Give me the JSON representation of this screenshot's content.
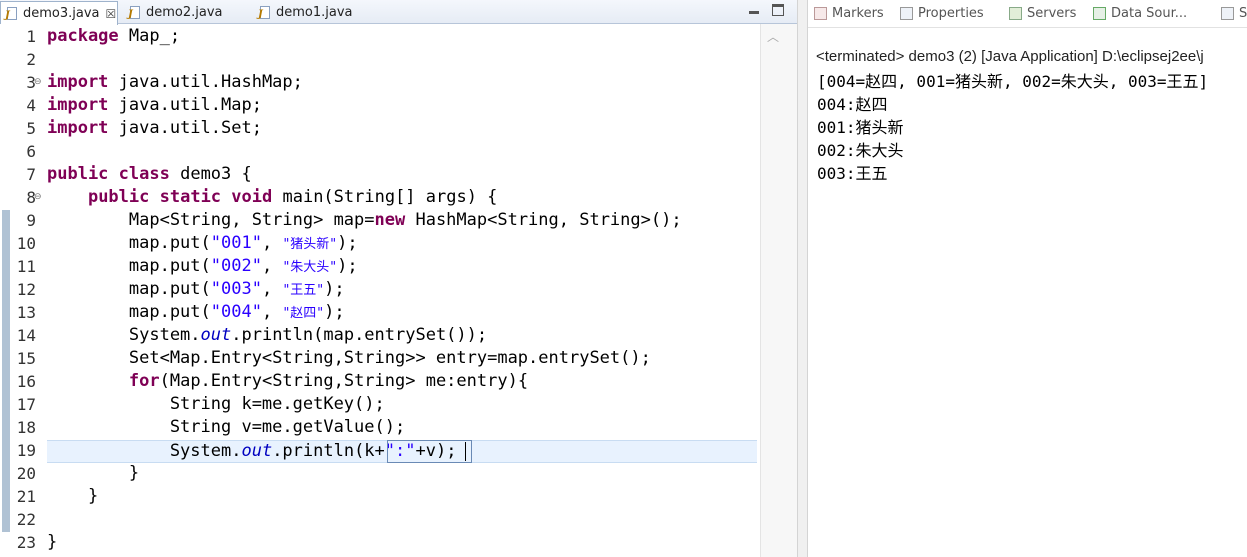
{
  "editor": {
    "tabs": [
      {
        "label": "demo3.java",
        "close": "☒",
        "active": true
      },
      {
        "label": "demo2.java",
        "active": false
      },
      {
        "label": "demo1.java",
        "active": false
      }
    ],
    "line_numbers": [
      "1",
      "2",
      "3",
      "4",
      "5",
      "6",
      "7",
      "8",
      "9",
      "10",
      "11",
      "12",
      "13",
      "14",
      "15",
      "16",
      "17",
      "18",
      "19",
      "20",
      "21",
      "22",
      "23"
    ],
    "current_line": 19
  },
  "console": {
    "tabs": [
      {
        "label": "Markers"
      },
      {
        "label": "Properties"
      },
      {
        "label": "Servers"
      },
      {
        "label": "Data Sour..."
      },
      {
        "label": "S"
      }
    ],
    "description": "<terminated> demo3 (2) [Java Application] D:\\eclipsej2ee\\j",
    "output": [
      "[004=赵四, 001=猪头新, 002=朱大头, 003=王五]",
      "004:赵四",
      "001:猪头新",
      "002:朱大头",
      "003:王五"
    ]
  },
  "code": {
    "l1": {
      "kw": "package",
      "rest": " Map_;"
    },
    "l3": {
      "kw": "import",
      "rest": " java.util.HashMap;"
    },
    "l4": {
      "kw": "import",
      "rest": " java.util.Map;"
    },
    "l5": {
      "kw": "import",
      "rest": " java.util.Set;"
    },
    "l7": {
      "kw1": "public",
      "kw2": "class",
      "rest": " demo3 {"
    },
    "l8": {
      "indent": "    ",
      "kw1": "public",
      "kw2": "static",
      "kw3": "void",
      "rest": " main(String[] args) {"
    },
    "l9": {
      "pre": "        Map<String, String> map=",
      "kw": "new",
      "post": " HashMap<String, String>();"
    },
    "puts": [
      {
        "pre": "        map.put(",
        "key": "\"001\"",
        "sep": ", ",
        "val": "\"猪头新\"",
        "post": ");"
      },
      {
        "pre": "        map.put(",
        "key": "\"002\"",
        "sep": ", ",
        "val": "\"朱大头\"",
        "post": ");"
      },
      {
        "pre": "        map.put(",
        "key": "\"003\"",
        "sep": ", ",
        "val": "\"王五\"",
        "post": ");"
      },
      {
        "pre": "        map.put(",
        "key": "\"004\"",
        "sep": ", ",
        "val": "\"赵四\"",
        "post": ");"
      }
    ],
    "l14": {
      "pre": "        System.",
      "fld": "out",
      "post": ".println(map.entrySet());"
    },
    "l15": {
      "text": "        Set<Map.Entry<String,String>> entry=map.entrySet();"
    },
    "l16": {
      "indent": "        ",
      "kw": "for",
      "rest": "(Map.Entry<String,String> me:entry){"
    },
    "l17": {
      "text": "            String k=me.getKey();"
    },
    "l18": {
      "text": "            String v=me.getValue();"
    },
    "l19": {
      "pre": "            System.",
      "fld": "out",
      "mid": ".println(k+",
      "str": "\":\"",
      "post": "+v);"
    },
    "l20": {
      "text": "        }"
    },
    "l21": {
      "text": "    }"
    },
    "l23": {
      "text": "}"
    }
  }
}
